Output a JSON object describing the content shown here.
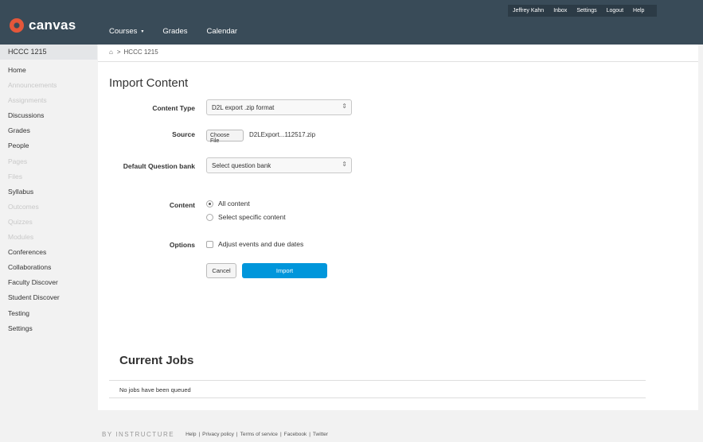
{
  "header": {
    "logo_text": "canvas",
    "nav": [
      {
        "label": "Courses",
        "caret": "▾"
      },
      {
        "label": "Grades"
      },
      {
        "label": "Calendar"
      }
    ],
    "user_links": [
      "Jeffrey Kahn",
      "Inbox",
      "Settings",
      "Logout",
      "Help"
    ]
  },
  "sidebar": {
    "course_code": "HCCC 1215",
    "items": [
      {
        "label": "Home"
      },
      {
        "label": "Announcements"
      },
      {
        "label": "Assignments"
      },
      {
        "label": "Discussions"
      },
      {
        "label": "Grades"
      },
      {
        "label": "People"
      },
      {
        "label": "Pages"
      },
      {
        "label": "Files"
      },
      {
        "label": "Syllabus"
      },
      {
        "label": "Outcomes"
      },
      {
        "label": "Quizzes"
      },
      {
        "label": "Modules"
      },
      {
        "label": "Conferences"
      },
      {
        "label": "Collaborations"
      },
      {
        "label": "Faculty Discover"
      },
      {
        "label": "Student Discover"
      },
      {
        "label": "Testing"
      },
      {
        "label": "Settings"
      }
    ]
  },
  "breadcrumb": {
    "home_icon": "⌂",
    "sep": ">",
    "course": "HCCC 1215"
  },
  "page": {
    "title": "Import Content",
    "content_type_label": "Content Type",
    "content_type_value": "D2L export .zip format",
    "source_label": "Source",
    "choose_file": "Choose File",
    "file_name": "D2LExport...112517.zip",
    "question_bank_label": "Default Question bank",
    "question_bank_value": "Select question bank",
    "content_label": "Content",
    "content_options": [
      "All content",
      "Select specific content"
    ],
    "options_label": "Options",
    "options_checkbox": "Adjust events and due dates",
    "cancel": "Cancel",
    "import": "Import"
  },
  "jobs": {
    "title": "Current Jobs",
    "empty": "No jobs have been queued"
  },
  "footer": {
    "brand": "BY INSTRUCTURE",
    "links": [
      "Help",
      "Privacy policy",
      "Terms of service",
      "Facebook",
      "Twitter"
    ]
  }
}
